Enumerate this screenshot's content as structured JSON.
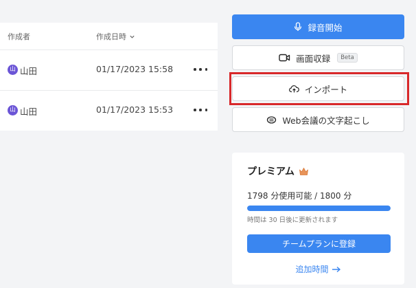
{
  "table": {
    "headers": {
      "author": "作成者",
      "created": "作成日時"
    },
    "rows": [
      {
        "avatar": "山",
        "author": "山田",
        "created": "01/17/2023 15:58"
      },
      {
        "avatar": "山",
        "author": "山田",
        "created": "01/17/2023 15:53"
      }
    ]
  },
  "actions": {
    "record": "録音開始",
    "screen_record": "画面収録",
    "beta_badge": "Beta",
    "import": "インポート",
    "web_meeting": "Web会議の文字起こし"
  },
  "premium": {
    "title": "プレミアム",
    "usage": "1798 分使用可能 / 1800 分",
    "usage_fraction": 0.9989,
    "reset_note": "時間は 30 日後に更新されます",
    "team_plan_button": "チームプランに登録",
    "add_time_link": "追加時間"
  },
  "colors": {
    "accent": "#3a86f0",
    "highlight": "#d8282a",
    "avatar": "#6b55d6",
    "crown": "#e8945a"
  },
  "icons": {
    "record": "microphone-icon",
    "screen_record": "video-camera-icon",
    "import": "cloud-upload-icon",
    "web_meeting": "meeting-icon",
    "premium": "crown-icon",
    "add_time": "arrow-right-icon",
    "sort": "chevron-down-icon",
    "row_menu": "more-horizontal-icon"
  }
}
